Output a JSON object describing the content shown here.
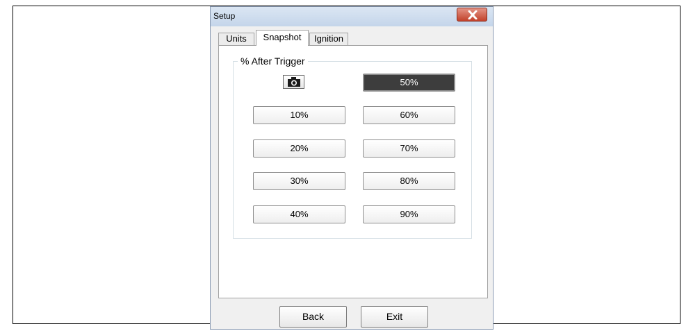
{
  "window": {
    "title": "Setup"
  },
  "tabs": [
    {
      "label": "Units"
    },
    {
      "label": "Snapshot"
    },
    {
      "label": "Ignition"
    }
  ],
  "active_tab": "Snapshot",
  "group": {
    "label": "% After Trigger"
  },
  "options": {
    "p10": "10%",
    "p20": "20%",
    "p30": "30%",
    "p40": "40%",
    "p50": "50%",
    "p60": "60%",
    "p70": "70%",
    "p80": "80%",
    "p90": "90%"
  },
  "selected_option": "50%",
  "footer": {
    "back_label": "Back",
    "exit_label": "Exit"
  },
  "icons": {
    "close": "close-icon",
    "camera": "camera-icon"
  },
  "colors": {
    "selected_bg": "#3d3d3d",
    "close_red": "#c2422c"
  }
}
